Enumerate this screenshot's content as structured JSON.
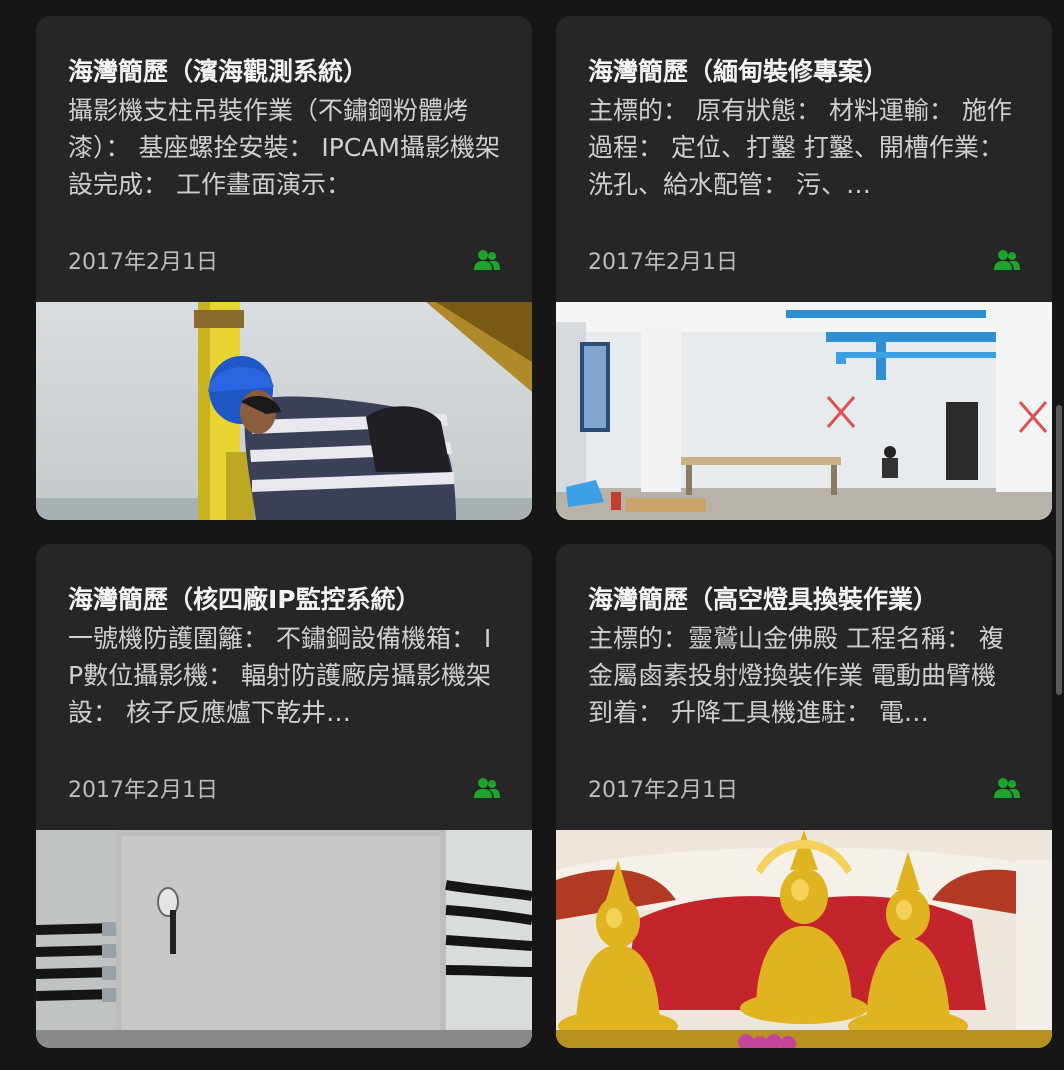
{
  "accent_color": "#1fa32f",
  "cards": [
    {
      "title": "海灣簡歷（濱海觀測系統）",
      "snippet": "攝影機支柱吊裝作業（不鏽鋼粉體烤漆）： 基座螺拴安裝： IPCAM攝影機架設完成： 工作畫面演示：",
      "date": "2017年2月1日",
      "icon": "shared-people-icon",
      "image": "worker-in-blue-helmet-by-sea"
    },
    {
      "title": "海灣簡歷（緬甸裝修專案）",
      "snippet": "主標的： 原有狀態： 材料運輸： 施作過程： 定位、打鑿 打鑿、開槽作業： 洗孔、給水配管： 污、…",
      "date": "2017年2月1日",
      "icon": "shared-people-icon",
      "image": "building-interior-under-renovation"
    },
    {
      "title": "海灣簡歷（核四廠IP監控系統）",
      "snippet": "一號機防護圍籬： 不鏽鋼設備機箱： IP數位攝影機： 輻射防護廠房攝影機架設： 核子反應爐下乾井…",
      "date": "2017年2月1日",
      "icon": "shared-people-icon",
      "image": "stainless-steel-cabinet-with-conduits"
    },
    {
      "title": "海灣簡歷（高空燈具換裝作業）",
      "snippet": "主標的：靈鷲山金佛殿 工程名稱： 複金屬鹵素投射燈換裝作業 電動曲臂機到着： 升降工具機進駐： 電…",
      "date": "2017年2月1日",
      "icon": "shared-people-icon",
      "image": "golden-buddha-statues-in-temple"
    }
  ]
}
